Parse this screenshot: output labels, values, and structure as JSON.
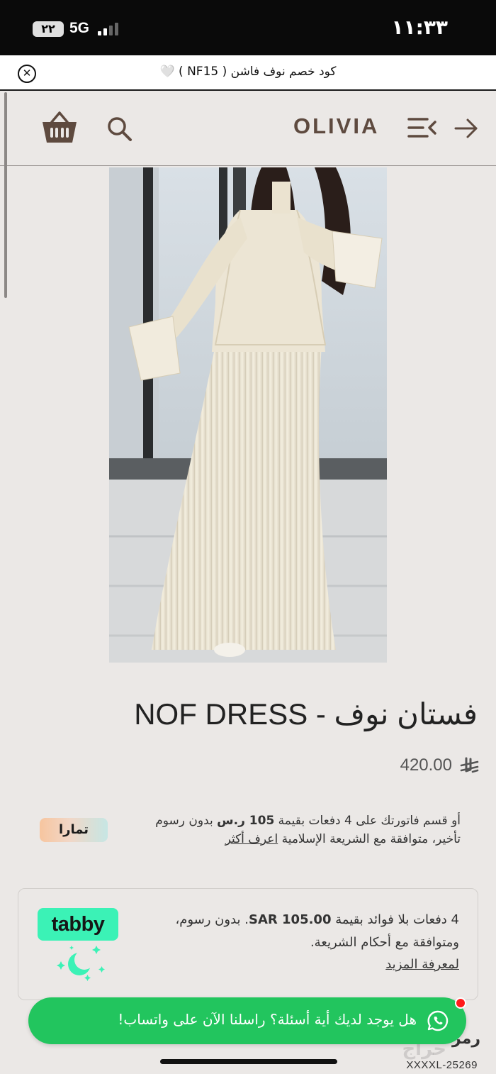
{
  "status_bar": {
    "time": "١١:٣٣",
    "network": "5G",
    "battery": "٢٢"
  },
  "promo": {
    "text": "كود خصم نوف فاشن ( NF15 ) 🤍",
    "close_icon": "close-circle-icon"
  },
  "header": {
    "logo": "OLIVIA",
    "icons": [
      "cart-icon",
      "search-icon",
      "menu-icon",
      "arrow-right-icon"
    ]
  },
  "product": {
    "image_icon": "product-photo",
    "title": "فستان نوف - NOF DRESS",
    "price": "420.00",
    "currency_icon": "saudi-riyal-symbol-icon"
  },
  "tamara": {
    "text_part1": "أو قسم فاتورتك على 4 دفعات بقيمة ",
    "amount": "105 ر.س",
    "text_part2": " بدون رسوم تأخير، متوافقة مع الشريعة الإسلامية ",
    "link": "اعرف أكثر",
    "badge": "تمارا"
  },
  "tabby": {
    "text_part1": "4 دفعات بلا فوائد بقيمة ",
    "amount": "SAR 105.00",
    "text_part2": ". بدون رسوم، ومتوافقة مع أحكام الشريعة.",
    "link": "لمعرفة المزيد",
    "logo": "tabby"
  },
  "whatsapp": {
    "text": "هل يوجد لديك أية أسئلة؟ راسلنا الآن على واتساب!",
    "icon": "whatsapp-icon"
  },
  "partial_text": "رمز",
  "watermark": {
    "code": "XXXXL-25269",
    "logo": "حراج"
  },
  "colors": {
    "background": "#ebe8e6",
    "logo": "#5e4a3f",
    "tabby": "#3bf2b6",
    "whatsapp": "#22c55e"
  }
}
